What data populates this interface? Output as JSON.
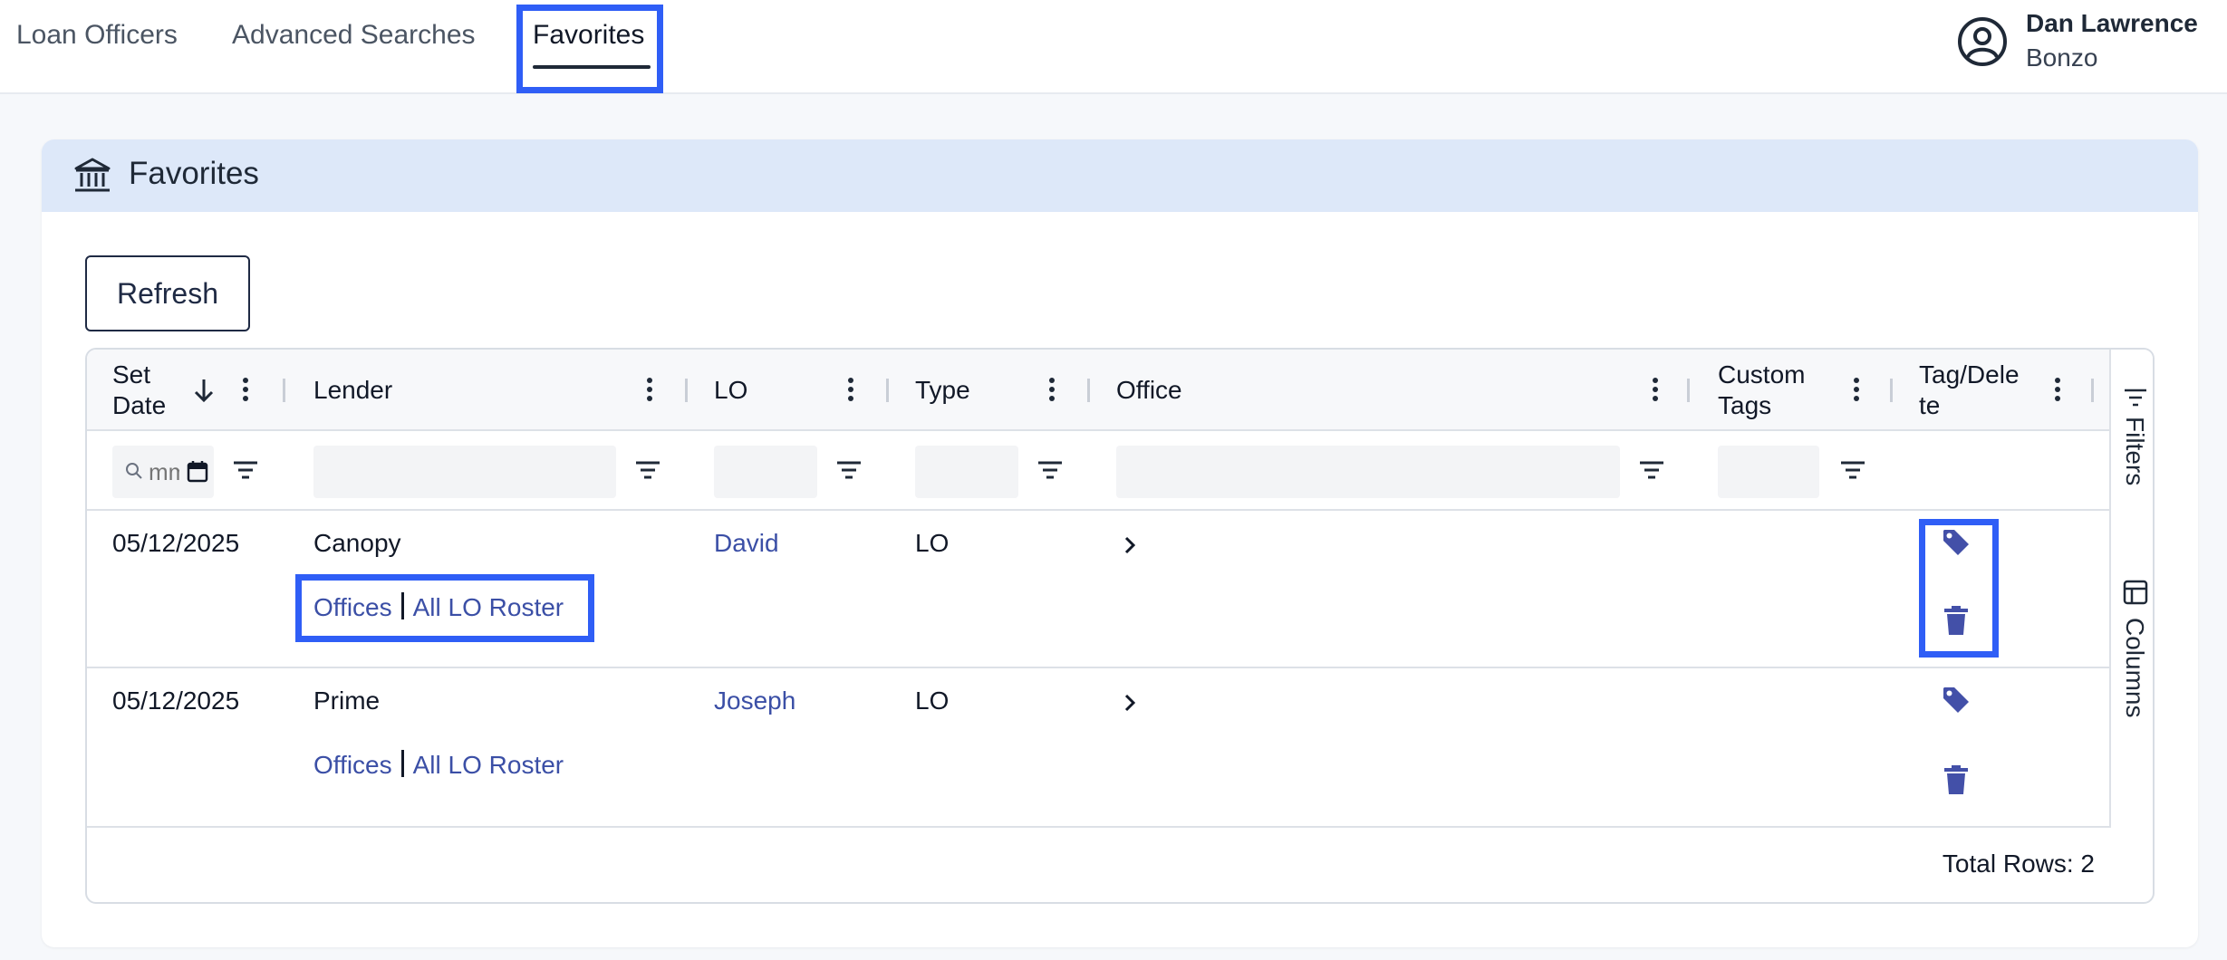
{
  "nav": {
    "items": [
      {
        "label": "Loan Officers"
      },
      {
        "label": "Advanced Searches"
      },
      {
        "label": "Favorites"
      }
    ],
    "active": "Favorites"
  },
  "user": {
    "name": "Dan Lawrence",
    "org": "Bonzo",
    "icon": "user-circle-icon"
  },
  "card": {
    "title": "Favorites",
    "icon": "bank-icon",
    "refresh_label": "Refresh"
  },
  "grid": {
    "columns": [
      {
        "line1": "Set",
        "line2": "Date",
        "sorted": "descending"
      },
      {
        "line1": "Lender",
        "line2": ""
      },
      {
        "line1": "LO",
        "line2": ""
      },
      {
        "line1": "Type",
        "line2": ""
      },
      {
        "line1": "Office",
        "line2": ""
      },
      {
        "line1": "Custom",
        "line2": "Tags"
      },
      {
        "line1": "Tag/Dele",
        "line2": "te"
      }
    ],
    "date_filter_placeholder": "mm/dd/yyyy",
    "rows": [
      {
        "set_date": "05/12/2025",
        "lender": "Canopy",
        "offices_link": "Offices",
        "roster_link": "All LO Roster",
        "lo": "David",
        "type": "LO"
      },
      {
        "set_date": "05/12/2025",
        "lender": "Prime",
        "offices_link": "Offices",
        "roster_link": "All LO Roster",
        "lo": "Joseph",
        "type": "LO"
      }
    ],
    "total_rows": "Total Rows: 2",
    "side_panel": {
      "filters_label": "Filters",
      "columns_label": "Columns"
    }
  },
  "colors": {
    "highlight": "#2f5ef6",
    "link": "#3b4fa6",
    "header_band": "#dde8f9",
    "icon_accent": "#4350a8"
  }
}
